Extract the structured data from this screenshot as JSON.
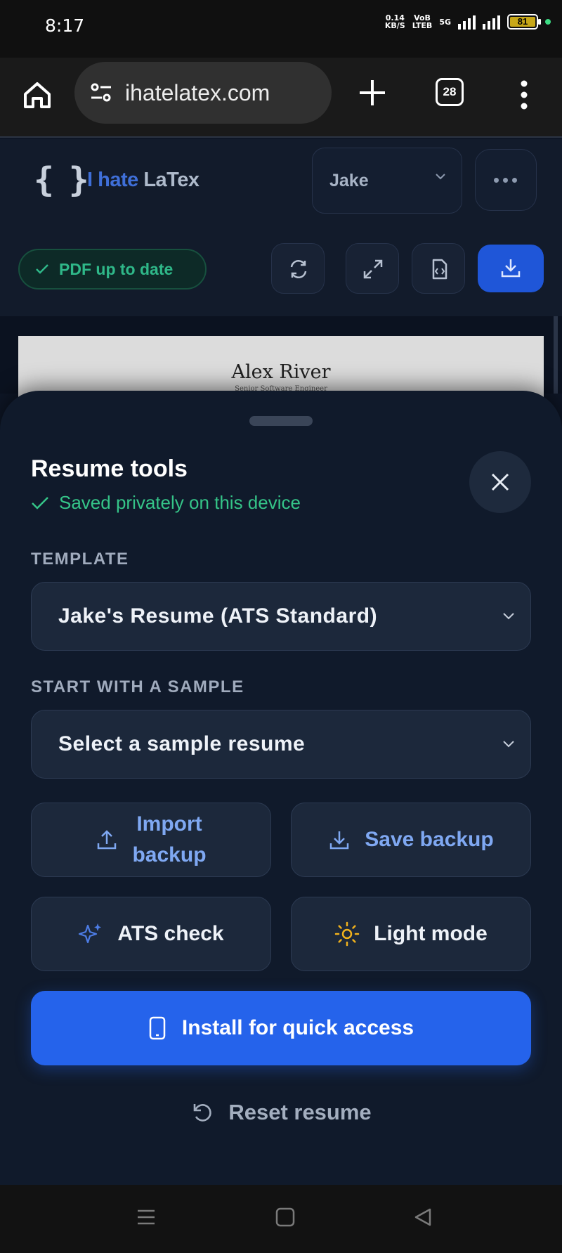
{
  "statusbar": {
    "time": "8:17",
    "net_speed_top": "0.14",
    "net_speed_bottom": "KB/S",
    "volte_top": "VoB",
    "volte_bottom": "LTEB",
    "signal_label": "5G",
    "battery": "81"
  },
  "browser": {
    "url": "ihatelatex.com",
    "tab_count": "28"
  },
  "app": {
    "brand_part1": "I hate",
    "brand_part2": "LaTex",
    "profile": "Jake",
    "pdf_status": "PDF up to date"
  },
  "preview": {
    "name": "Alex River",
    "subtitle": "Senior Software Engineer"
  },
  "sheet": {
    "title": "Resume tools",
    "saved_status": "Saved privately on this device",
    "template_label": "TEMPLATE",
    "template_value": "Jake's Resume (ATS Standard)",
    "sample_label": "START WITH A SAMPLE",
    "sample_placeholder": "Select a sample resume",
    "import_line1": "Import",
    "import_line2": "backup",
    "save_backup": "Save backup",
    "ats_check": "ATS check",
    "light_mode": "Light mode",
    "install": "Install for quick access",
    "reset": "Reset resume"
  },
  "colors": {
    "accent_blue": "#2563eb",
    "success_green": "#35c488",
    "sheet_bg": "#101a2b"
  }
}
